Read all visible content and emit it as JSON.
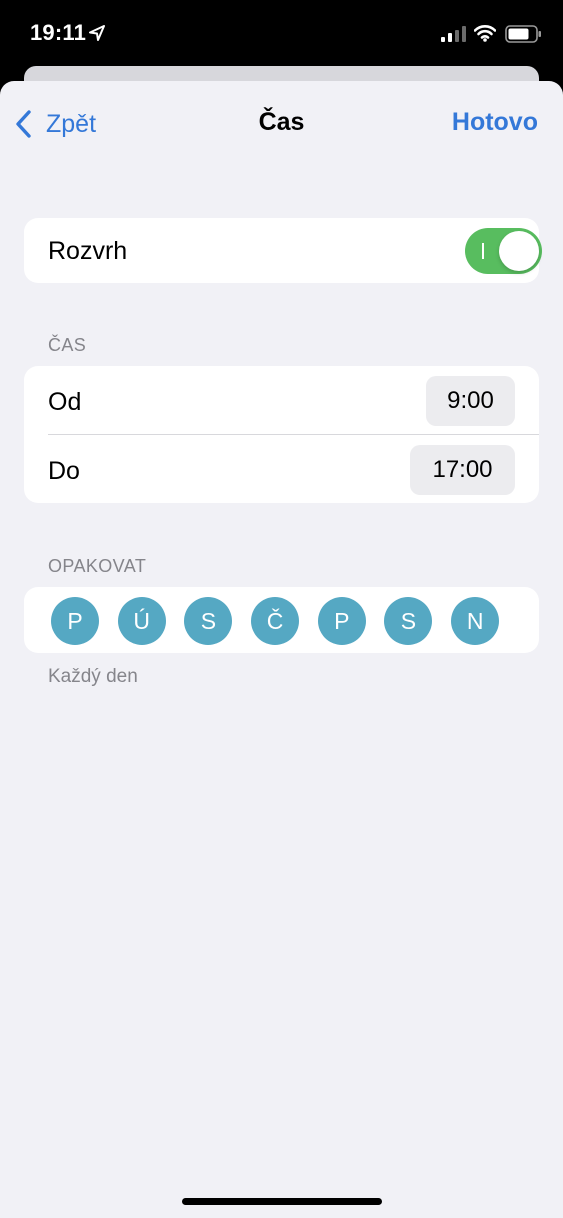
{
  "status_bar": {
    "time": "19:11",
    "icons": [
      "location-arrow-icon",
      "cellular-signal-icon",
      "wifi-icon",
      "battery-icon"
    ]
  },
  "nav": {
    "back_label": "Zpět",
    "title": "Čas",
    "done_label": "Hotovo"
  },
  "schedule": {
    "label": "Rozvrh",
    "enabled": true
  },
  "time_section": {
    "header": "ČAS",
    "from_label": "Od",
    "from_value": "9:00",
    "to_label": "Do",
    "to_value": "17:00"
  },
  "repeat_section": {
    "header": "OPAKOVAT",
    "days": [
      "P",
      "Ú",
      "S",
      "Č",
      "P",
      "S",
      "N"
    ],
    "summary": "Každý den"
  },
  "colors": {
    "accent": "#3478d8",
    "toggle_on": "#58bd5f",
    "day_selected": "#55a8c3",
    "background": "#f1f1f6"
  }
}
